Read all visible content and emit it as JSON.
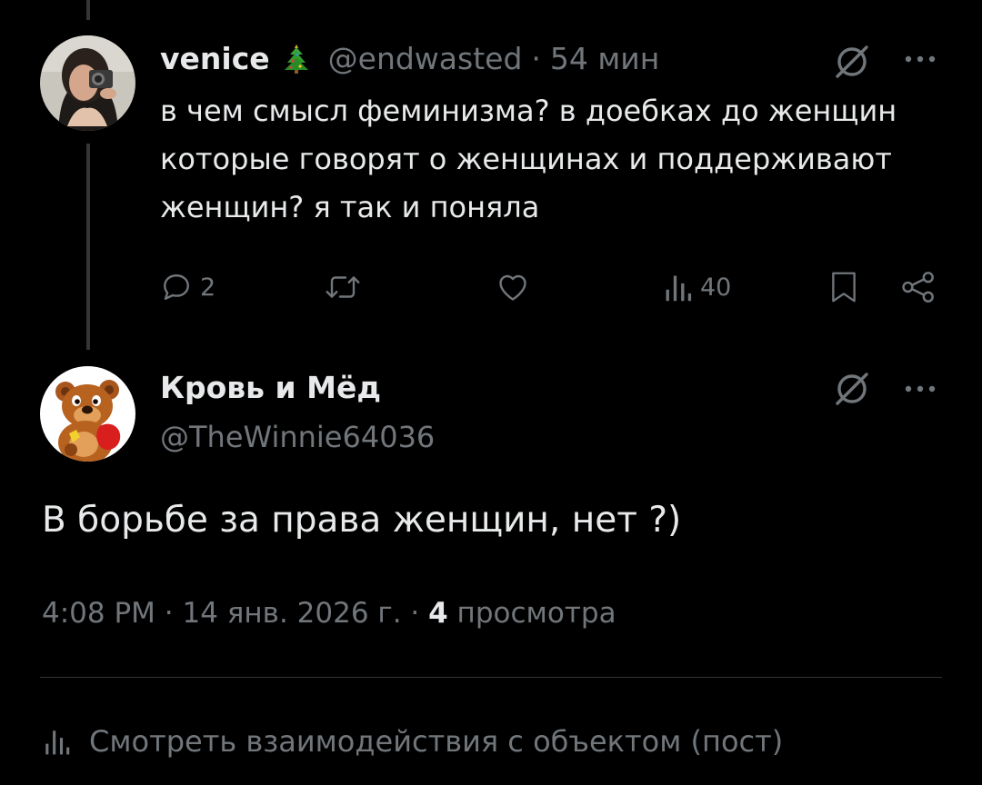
{
  "parent_post": {
    "author": {
      "display_name": "venice",
      "handle": "@endwasted",
      "separator": "·",
      "time": "54 мин"
    },
    "text": "в чем смысл феминизма? в доебках до женщин которые говорят о женщинах и поддерживают женщин? я так и поняла",
    "actions": {
      "replies": "2",
      "views": "40"
    }
  },
  "reply_post": {
    "author": {
      "display_name": "Кровь и Мёд",
      "handle": "@TheWinnie64036"
    },
    "text": "В борьбе за права женщин, нет ?)",
    "meta": {
      "time": "4:08 PM · 14 янв. 2026 г. · ",
      "views_count": "4",
      "views_label": " просмотра"
    }
  },
  "engagements_link": "Смотреть взаимодействия с объектом (пост)",
  "icons": {
    "parent_avatar": "profile-photo",
    "tree_emoji": "christmas-tree-icon",
    "grok": "grok-icon",
    "more": "more-icon",
    "reply": "reply-icon",
    "repost": "repost-icon",
    "like": "like-icon",
    "views": "views-icon",
    "bookmark": "bookmark-icon",
    "share": "share-icon",
    "reply_avatar": "winnie-the-pooh-avatar"
  },
  "colors": {
    "background": "#000000",
    "primary_text": "#e7e9ea",
    "secondary_text": "#71767b",
    "divider": "#2f3336",
    "thread_line": "#333639"
  }
}
